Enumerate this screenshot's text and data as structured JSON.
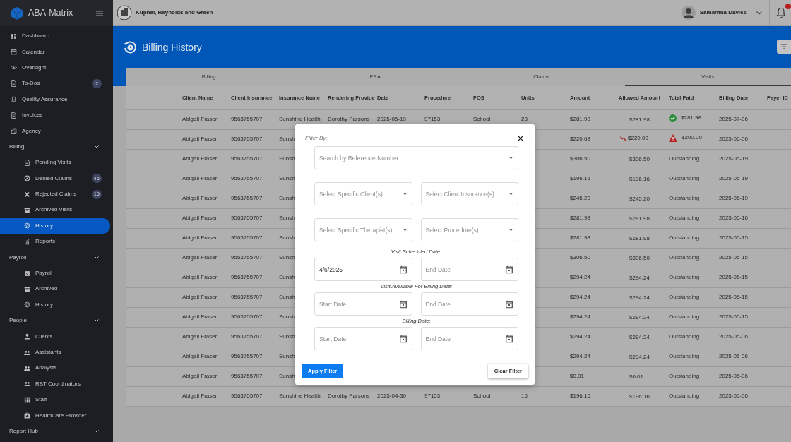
{
  "app": {
    "name": "ABA-Matrix"
  },
  "sidebar": {
    "items": [
      {
        "kind": "link",
        "label": "Dashboard",
        "selected": false
      },
      {
        "kind": "link",
        "label": "Calendar",
        "selected": false
      },
      {
        "kind": "link",
        "label": "Oversight",
        "selected": false
      },
      {
        "kind": "link",
        "label": "To-Dos",
        "badge": "2",
        "selected": false
      },
      {
        "kind": "link",
        "label": "Quality Assurance",
        "selected": false
      },
      {
        "kind": "link",
        "label": "Invoices",
        "selected": false
      },
      {
        "kind": "link",
        "label": "Agency",
        "selected": false
      },
      {
        "kind": "section",
        "label": "Billing",
        "children": [
          {
            "kind": "link",
            "label": "Pending Visits",
            "selected": false
          },
          {
            "kind": "link",
            "label": "Denied Claims",
            "badge": "45",
            "selected": false
          },
          {
            "kind": "link",
            "label": "Rejected Claims",
            "badge": "15",
            "selected": false
          },
          {
            "kind": "link",
            "label": "Archived Visits",
            "selected": false
          },
          {
            "kind": "link",
            "label": "History",
            "selected": true
          },
          {
            "kind": "link",
            "label": "Reports",
            "selected": false
          }
        ]
      },
      {
        "kind": "section",
        "label": "Payroll",
        "children": [
          {
            "kind": "link",
            "label": "Payroll",
            "selected": false
          },
          {
            "kind": "link",
            "label": "Archived",
            "selected": false
          },
          {
            "kind": "link",
            "label": "History",
            "selected": false
          }
        ]
      },
      {
        "kind": "section",
        "label": "People",
        "children": [
          {
            "kind": "link",
            "label": "Clients",
            "selected": false
          },
          {
            "kind": "link",
            "label": "Assistants",
            "selected": false
          },
          {
            "kind": "link",
            "label": "Analysts",
            "selected": false
          },
          {
            "kind": "link",
            "label": "RBT Coordinators",
            "selected": false
          },
          {
            "kind": "link",
            "label": "Staff",
            "selected": false
          },
          {
            "kind": "link",
            "label": "HealthCare Provider",
            "selected": false
          }
        ]
      },
      {
        "kind": "section",
        "label": "Report Hub"
      }
    ]
  },
  "top_bar": {
    "organization": "Kuphal, Reynolds and Green",
    "user": "Samantha Davies"
  },
  "page": {
    "title": "Billing History"
  },
  "tabs": [
    {
      "label": "Billing",
      "selected": false
    },
    {
      "label": "ERA",
      "selected": false
    },
    {
      "label": "Claims",
      "selected": false
    },
    {
      "label": "Visits",
      "selected": true
    }
  ],
  "table": {
    "columns": [
      "Client Name",
      "Client Insurance",
      "Insurance Name",
      "Rendering Provide",
      "Date",
      "Procedure",
      "POS",
      "Units",
      "Amount",
      "Allowed Amount",
      "Total Paid",
      "Billing Date",
      "Payer IC"
    ],
    "rows": [
      {
        "client_name": "Abigail Fraser",
        "client_insurance": "9563755707",
        "insurance_name": "Sunshine Health",
        "rendering_provider": "Dorothy Parsons",
        "date": "2025-05-19",
        "procedure": "97153",
        "pos": "School",
        "units": "23",
        "amount": "$281.98",
        "allowed_amount": "$281.98",
        "allowed_decreased": false,
        "total_paid": "$281.98",
        "kind": "paid",
        "billing_date": "2025-07-06"
      },
      {
        "client_name": "Abigail Fraser",
        "client_insurance": "9563755707",
        "insurance_name": "Sunsh",
        "amount": "$220.68",
        "allowed_amount": "$220.00",
        "allowed_decreased": true,
        "total_paid": "$200.00",
        "kind": "underpaid",
        "billing_date": "2025-06-06"
      },
      {
        "client_name": "Abigail Fraser",
        "client_insurance": "9563755707",
        "insurance_name": "Sunsh",
        "amount": "$306.50",
        "allowed_amount": "$306.50",
        "allowed_decreased": false,
        "total_paid": "Outstanding",
        "kind": "outstanding",
        "billing_date": "2025-05-19"
      },
      {
        "client_name": "Abigail Fraser",
        "client_insurance": "9563755707",
        "insurance_name": "Sunsh",
        "amount": "$196.16",
        "allowed_amount": "$196.16",
        "allowed_decreased": false,
        "total_paid": "Outstanding",
        "kind": "outstanding",
        "billing_date": "2025-05-19"
      },
      {
        "client_name": "Abigail Fraser",
        "client_insurance": "9563755707",
        "insurance_name": "Sunsh",
        "amount": "$245.20",
        "allowed_amount": "$245.20",
        "allowed_decreased": false,
        "total_paid": "Outstanding",
        "kind": "outstanding",
        "billing_date": "2025-05-19"
      },
      {
        "client_name": "Abigail Fraser",
        "client_insurance": "9563755707",
        "insurance_name": "Sunsh",
        "amount": "$281.98",
        "allowed_amount": "$281.98",
        "allowed_decreased": false,
        "total_paid": "Outstanding",
        "kind": "outstanding",
        "billing_date": "2025-05-16"
      },
      {
        "client_name": "Abigail Fraser",
        "client_insurance": "9563755707",
        "insurance_name": "Sunsh",
        "amount": "$281.98",
        "allowed_amount": "$281.98",
        "allowed_decreased": false,
        "total_paid": "Outstanding",
        "kind": "outstanding",
        "billing_date": "2025-05-15"
      },
      {
        "client_name": "Abigail Fraser",
        "client_insurance": "9563755707",
        "insurance_name": "Sunsh",
        "amount": "$306.50",
        "allowed_amount": "$306.50",
        "allowed_decreased": false,
        "total_paid": "Outstanding",
        "kind": "outstanding",
        "billing_date": "2025-05-15"
      },
      {
        "client_name": "Abigail Fraser",
        "client_insurance": "9563755707",
        "insurance_name": "Sunsh",
        "amount": "$294.24",
        "allowed_amount": "$294.24",
        "allowed_decreased": false,
        "total_paid": "Outstanding",
        "kind": "outstanding",
        "billing_date": "2025-05-15"
      },
      {
        "client_name": "Abigail Fraser",
        "client_insurance": "9563755707",
        "insurance_name": "Sunsh",
        "amount": "$294.24",
        "allowed_amount": "$294.24",
        "allowed_decreased": false,
        "total_paid": "Outstanding",
        "kind": "outstanding",
        "billing_date": "2025-05-15"
      },
      {
        "client_name": "Abigail Fraser",
        "client_insurance": "9563755707",
        "insurance_name": "Sunsh",
        "amount": "$294.24",
        "allowed_amount": "$294.24",
        "allowed_decreased": false,
        "total_paid": "Outstanding",
        "kind": "outstanding",
        "billing_date": "2025-05-15"
      },
      {
        "client_name": "Abigail Fraser",
        "client_insurance": "9563755707",
        "insurance_name": "Sunsh",
        "amount": "$294.24",
        "allowed_amount": "$294.24",
        "allowed_decreased": false,
        "total_paid": "Outstanding",
        "kind": "outstanding",
        "billing_date": "2025-05-06"
      },
      {
        "client_name": "Abigail Fraser",
        "client_insurance": "9563755707",
        "insurance_name": "Sunsh",
        "amount": "$294.24",
        "allowed_amount": "$294.24",
        "allowed_decreased": false,
        "total_paid": "Outstanding",
        "kind": "outstanding",
        "billing_date": "2025-05-06"
      },
      {
        "client_name": "Abigail Fraser",
        "client_insurance": "9563755707",
        "insurance_name": "Sunsh",
        "amount": "$0.01",
        "allowed_amount": "$0.01",
        "allowed_decreased": false,
        "total_paid": "Outstanding",
        "kind": "outstanding",
        "billing_date": "2025-05-06"
      },
      {
        "client_name": "Abigail Fraser",
        "client_insurance": "9563755707",
        "insurance_name": "Sunshine Health",
        "rendering_provider": "Dorothy Parsons",
        "date": "2025-04-30",
        "procedure": "97153",
        "pos": "School",
        "units": "16",
        "amount": "$196.16",
        "allowed_amount": "$196.16",
        "allowed_decreased": false,
        "total_paid": "Outstanding",
        "kind": "outstanding",
        "billing_date": "2025-05-06"
      }
    ]
  },
  "filter_modal": {
    "title": "Filter By:",
    "search": {
      "placeholder": "Search by Reference Number:"
    },
    "selects": [
      {
        "placeholder": "Select Specific Client(s)"
      },
      {
        "placeholder": "Select Client Insurance(s)"
      },
      {
        "placeholder": "Select Specific Therapist(s)"
      },
      {
        "placeholder": "Select Procedure(s)"
      }
    ],
    "date_ranges": [
      {
        "label": "Visit Scheduled Date:",
        "start": {
          "value": "4/6/2025"
        },
        "end": {
          "placeholder": "End Date"
        }
      },
      {
        "label": "Visit Available For Billing Date:",
        "start": {
          "placeholder": "Start Date"
        },
        "end": {
          "placeholder": "End Date"
        }
      },
      {
        "label": "Billing Date:",
        "start": {
          "placeholder": "Start Date"
        },
        "end": {
          "placeholder": "End Date"
        }
      }
    ],
    "apply_button": "Apply Filter",
    "clear_button": "Clear Filter"
  }
}
